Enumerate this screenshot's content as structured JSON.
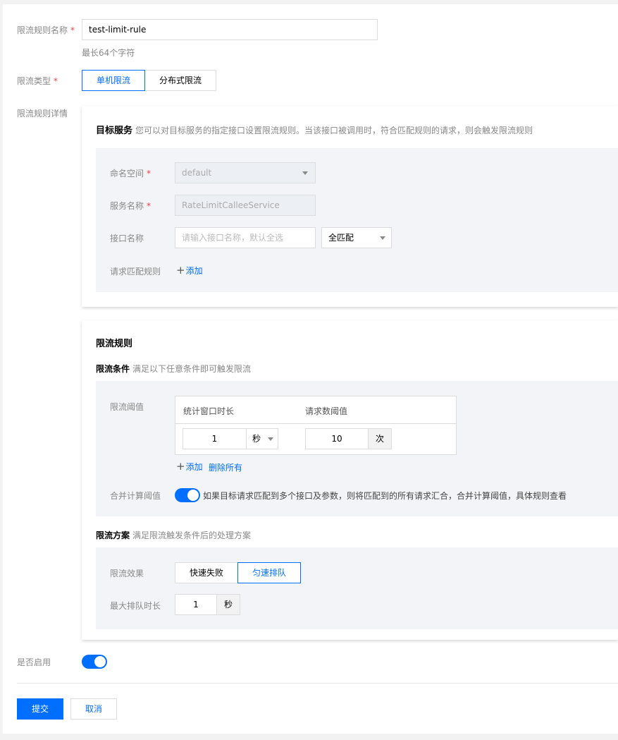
{
  "form": {
    "rule_name": {
      "label": "限流规则名称",
      "required": "*",
      "value": "test-limit-rule",
      "hint": "最长64个字符"
    },
    "limit_type": {
      "label": "限流类型",
      "required": "*",
      "options": [
        "单机限流",
        "分布式限流"
      ],
      "selected": "单机限流"
    },
    "rule_detail_label": "限流规则详情",
    "enabled": {
      "label": "是否启用",
      "on": true
    }
  },
  "target": {
    "title": "目标服务",
    "desc": "您可以对目标服务的指定接口设置限流规则。当该接口被调用时，符合匹配规则的请求，则会触发限流规则",
    "namespace": {
      "label": "命名空间",
      "required": "*",
      "value": "default"
    },
    "service": {
      "label": "服务名称",
      "required": "*",
      "value": "RateLimitCalleeService"
    },
    "interface": {
      "label": "接口名称",
      "placeholder": "请输入接口名称，默认全选",
      "match": "全匹配"
    },
    "match_rule": {
      "label": "请求匹配规则",
      "add": "添加"
    }
  },
  "rule": {
    "title": "限流规则",
    "condition": {
      "title": "限流条件",
      "desc": "满足以下任意条件即可触发限流"
    },
    "threshold": {
      "label": "限流阈值",
      "headers": [
        "统计窗口时长",
        "请求数阈值"
      ],
      "rows": [
        {
          "window": "1",
          "window_unit": "秒",
          "count": "10",
          "count_unit": "次"
        }
      ],
      "add": "添加",
      "delete_all": "删除所有"
    },
    "merge": {
      "label": "合并计算阈值",
      "on": true,
      "desc": "如果目标请求匹配到多个接口及参数，则将匹配到的所有请求汇合，合并计算阈值，具体规则查看"
    },
    "plan": {
      "title": "限流方案",
      "desc": "满足限流触发条件后的处理方案"
    },
    "effect": {
      "label": "限流效果",
      "options": [
        "快速失败",
        "匀速排队"
      ],
      "selected": "匀速排队"
    },
    "max_queue": {
      "label": "最大排队时长",
      "value": "1",
      "unit": "秒"
    }
  },
  "actions": {
    "submit": "提交",
    "cancel": "取消"
  },
  "colors": {
    "accent": "#006eff",
    "required": "#e54545"
  }
}
